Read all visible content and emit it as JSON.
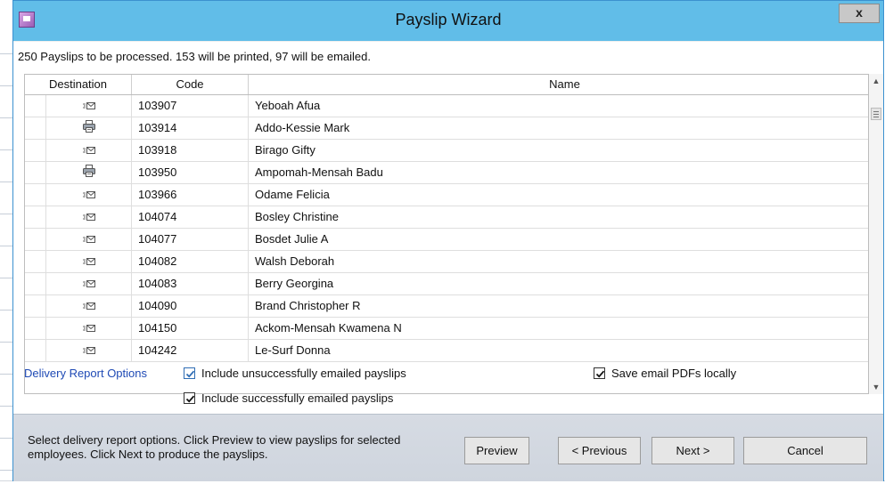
{
  "window": {
    "title": "Payslip Wizard",
    "close_label": "x"
  },
  "summary": "250 Payslips to be processed.  153 will be printed, 97 will be emailed.",
  "table": {
    "columns": [
      "Destination",
      "Code",
      "Name"
    ],
    "rows": [
      {
        "destination": "email",
        "code": "103907",
        "name": "Yeboah Afua"
      },
      {
        "destination": "print",
        "code": "103914",
        "name": "Addo-Kessie Mark"
      },
      {
        "destination": "email",
        "code": "103918",
        "name": "Birago Gifty"
      },
      {
        "destination": "print",
        "code": "103950",
        "name": "Ampomah-Mensah Badu"
      },
      {
        "destination": "email",
        "code": "103966",
        "name": "Odame Felicia"
      },
      {
        "destination": "email",
        "code": "104074",
        "name": "Bosley Christine"
      },
      {
        "destination": "email",
        "code": "104077",
        "name": "Bosdet Julie A"
      },
      {
        "destination": "email",
        "code": "104082",
        "name": "Walsh Deborah"
      },
      {
        "destination": "email",
        "code": "104083",
        "name": "Berry Georgina"
      },
      {
        "destination": "email",
        "code": "104090",
        "name": "Brand Christopher R"
      },
      {
        "destination": "email",
        "code": "104150",
        "name": "Ackom-Mensah Kwamena N"
      },
      {
        "destination": "email",
        "code": "104242",
        "name": "Le-Surf Donna"
      }
    ]
  },
  "delivery": {
    "label": "Delivery Report Options",
    "opt_unsuccessful": {
      "label": "Include unsuccessfully emailed payslips",
      "checked": true
    },
    "opt_successful": {
      "label": "Include successfully emailed payslips",
      "checked": true
    },
    "opt_save_pdf": {
      "label": "Save email PDFs locally",
      "checked": true
    }
  },
  "footer": {
    "instructions": "Select delivery report options. Click Preview to view payslips for selected employees. Click Next to produce the payslips.",
    "preview": "Preview",
    "previous": "< Previous",
    "next": "Next >",
    "cancel": "Cancel"
  },
  "colors": {
    "titlebar": "#61bde8",
    "link_blue": "#1f4ab5",
    "footer": "#d6dbe3"
  }
}
